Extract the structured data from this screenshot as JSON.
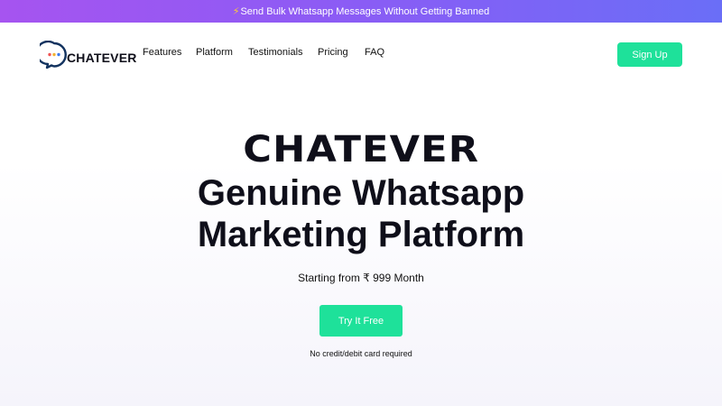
{
  "announcement": {
    "icon": "lightning-icon",
    "text": "Send Bulk Whatsapp Messages Without Getting Banned"
  },
  "header": {
    "logo_text": "CHATEVER",
    "nav": [
      {
        "label": "Features"
      },
      {
        "label": "Platform"
      },
      {
        "label": "Testimonials"
      },
      {
        "label": "Pricing"
      },
      {
        "label": "FAQ"
      }
    ],
    "signup_label": "Sign Up"
  },
  "hero": {
    "brand": "CHATEVER",
    "headline_line1": "Genuine Whatsapp",
    "headline_line2": "Marketing Platform",
    "price_text": "Starting from ₹ 999 Month",
    "cta_label": "Try It Free",
    "note": "No credit/debit card required"
  },
  "colors": {
    "accent": "#1ee19a",
    "banner_start": "#a654f0",
    "banner_end": "#6a6ef7",
    "text": "#0f0f1a"
  }
}
